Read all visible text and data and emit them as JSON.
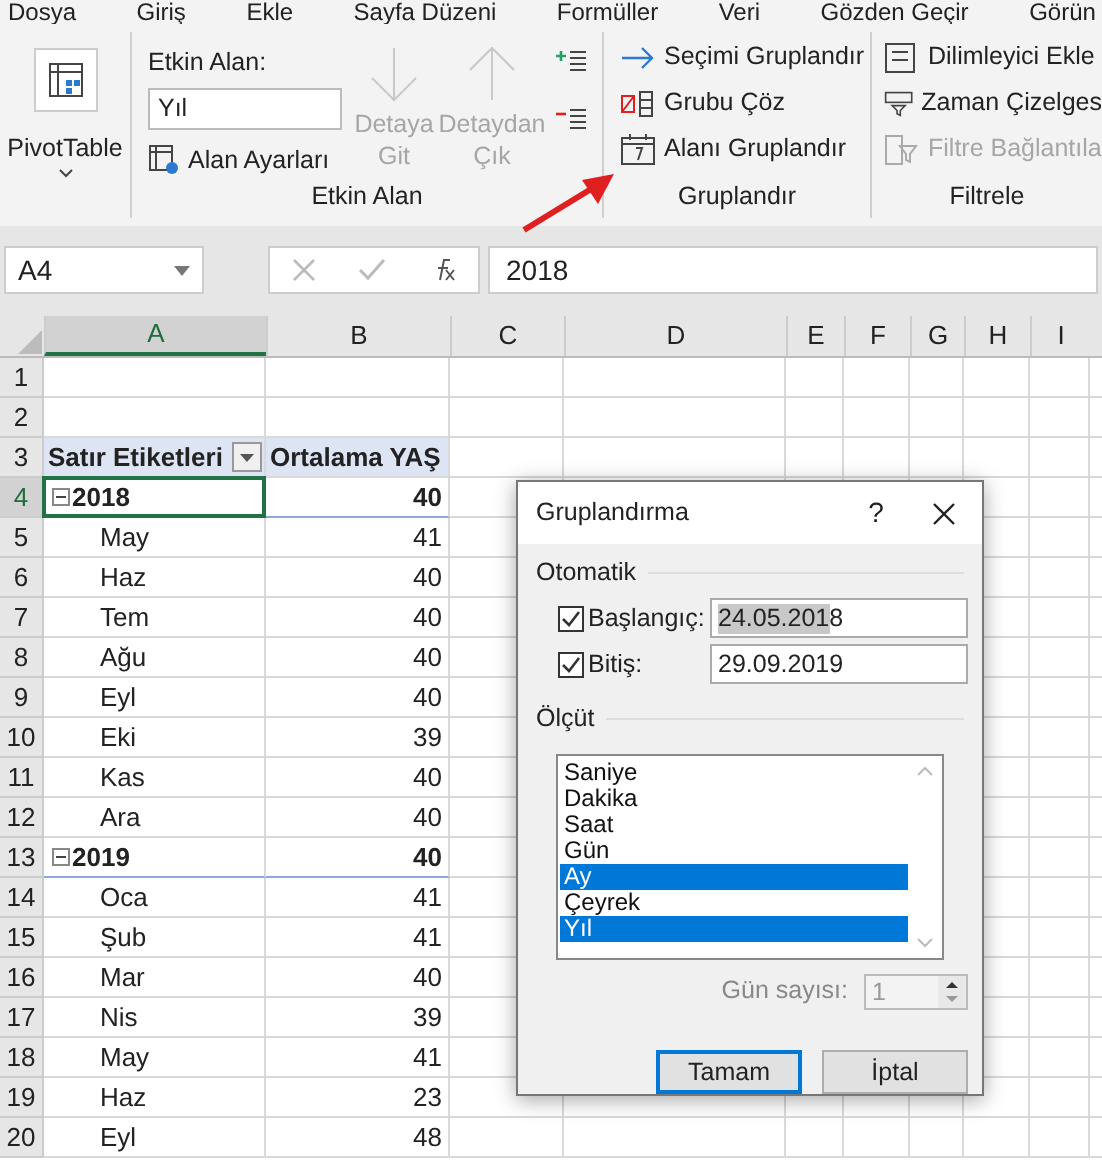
{
  "menu_tabs": [
    "Dosya",
    "Giriş",
    "Ekle",
    "Sayfa Düzeni",
    "Formüller",
    "Veri",
    "Gözden Geçir",
    "Görün"
  ],
  "ribbon": {
    "pivot_button": "PivotTable",
    "active_field": {
      "label": "Etkin Alan:",
      "value": "Yıl",
      "settings": "Alan Ayarları",
      "drill_down": {
        "label": "Detaya Git",
        "disabled": true
      },
      "drill_up": {
        "label": "Detaydan Çık",
        "disabled": true
      },
      "group_label": "Etkin Alan"
    },
    "group": {
      "items": [
        {
          "label": "Seçimi Gruplandır",
          "disabled": false
        },
        {
          "label": "Grubu Çöz",
          "disabled": false
        },
        {
          "label": "Alanı Gruplandır",
          "disabled": false
        }
      ],
      "group_label": "Gruplandır"
    },
    "filter": {
      "items": [
        {
          "label": "Dilimleyici Ekle",
          "disabled": false
        },
        {
          "label": "Zaman Çizelges",
          "disabled": false
        },
        {
          "label": "Filtre Bağlantıla",
          "disabled": true
        }
      ],
      "group_label": "Filtrele"
    }
  },
  "formula_bar": {
    "name_box": "A4",
    "formula": "2018"
  },
  "sheet": {
    "columns": [
      "A",
      "B",
      "C",
      "D",
      "E",
      "F",
      "G",
      "H",
      "I"
    ],
    "rows": [
      {
        "number": "1",
        "kind": "blank"
      },
      {
        "number": "2",
        "kind": "blank"
      },
      {
        "number": "3",
        "kind": "header",
        "label": "Satır Etiketleri",
        "value": "Ortalama YAŞ"
      },
      {
        "number": "4",
        "kind": "year",
        "label": "2018",
        "value": "40",
        "selected": true
      },
      {
        "number": "5",
        "kind": "month",
        "label": "May",
        "value": "41"
      },
      {
        "number": "6",
        "kind": "month",
        "label": "Haz",
        "value": "40"
      },
      {
        "number": "7",
        "kind": "month",
        "label": "Tem",
        "value": "40"
      },
      {
        "number": "8",
        "kind": "month",
        "label": "Ağu",
        "value": "40"
      },
      {
        "number": "9",
        "kind": "month",
        "label": "Eyl",
        "value": "40"
      },
      {
        "number": "10",
        "kind": "month",
        "label": "Eki",
        "value": "39"
      },
      {
        "number": "11",
        "kind": "month",
        "label": "Kas",
        "value": "40"
      },
      {
        "number": "12",
        "kind": "month",
        "label": "Ara",
        "value": "40"
      },
      {
        "number": "13",
        "kind": "year",
        "label": "2019",
        "value": "40",
        "selected": false
      },
      {
        "number": "14",
        "kind": "month",
        "label": "Oca",
        "value": "41"
      },
      {
        "number": "15",
        "kind": "month",
        "label": "Şub",
        "value": "41"
      },
      {
        "number": "16",
        "kind": "month",
        "label": "Mar",
        "value": "40"
      },
      {
        "number": "17",
        "kind": "month",
        "label": "Nis",
        "value": "39"
      },
      {
        "number": "18",
        "kind": "month",
        "label": "May",
        "value": "41"
      },
      {
        "number": "19",
        "kind": "month",
        "label": "Haz",
        "value": "23"
      },
      {
        "number": "20",
        "kind": "month",
        "label": "Eyl",
        "value": "48"
      }
    ]
  },
  "dialog": {
    "title": "Gruplandırma",
    "help": "?",
    "section_auto": "Otomatik",
    "start": {
      "label": "Başlangıç:",
      "checked": true,
      "value": "24.05.2018"
    },
    "end": {
      "label": "Bitiş:",
      "checked": true,
      "value": "29.09.2019"
    },
    "section_by": "Ölçüt",
    "units": [
      {
        "label": "Saniye",
        "selected": false
      },
      {
        "label": "Dakika",
        "selected": false
      },
      {
        "label": "Saat",
        "selected": false
      },
      {
        "label": "Gün",
        "selected": false
      },
      {
        "label": "Ay",
        "selected": true
      },
      {
        "label": "Çeyrek",
        "selected": false
      },
      {
        "label": "Yıl",
        "selected": true
      }
    ],
    "days": {
      "label": "Gün sayısı:",
      "value": "1",
      "disabled": true
    },
    "buttons": [
      "Tamam",
      "İptal"
    ]
  }
}
